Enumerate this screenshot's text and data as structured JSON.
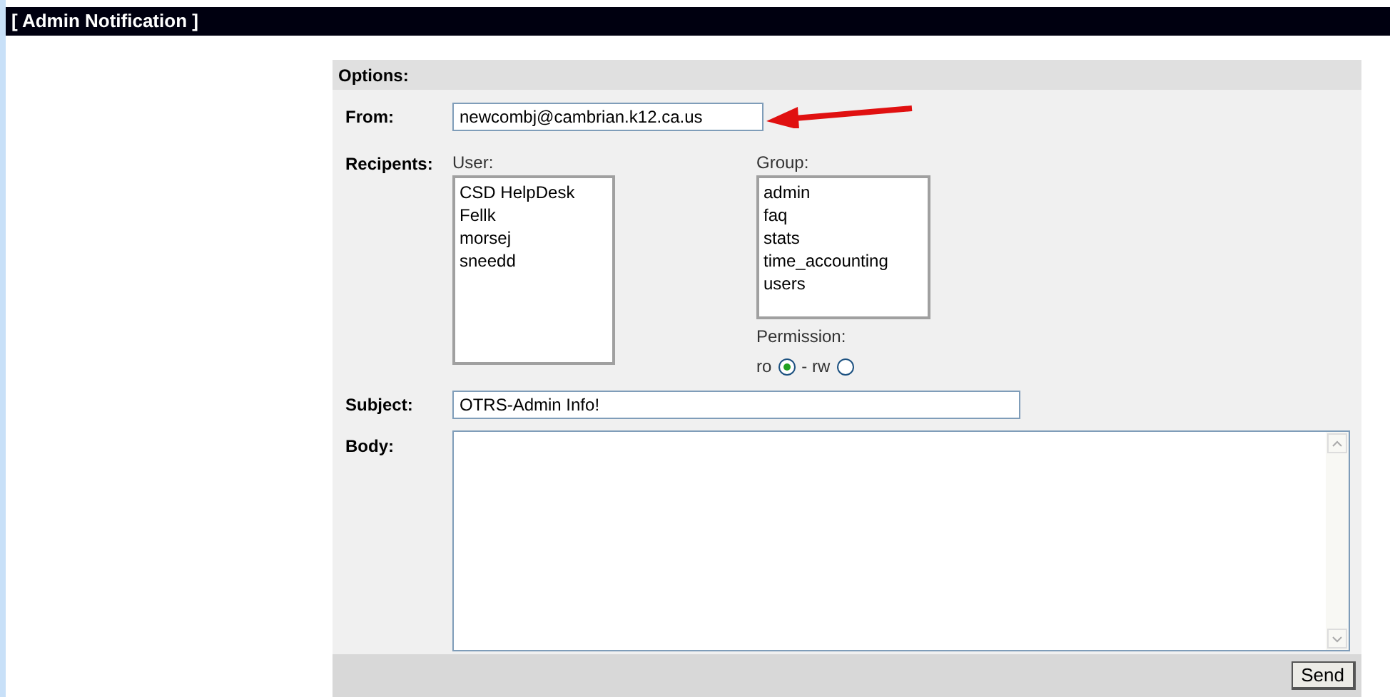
{
  "title": "[ Admin Notification ]",
  "options": {
    "header": "Options:",
    "from": {
      "label": "From:",
      "value": "newcombj@cambrian.k12.ca.us"
    },
    "recipients": {
      "label": "Recipents:",
      "user_label": "User:",
      "users": [
        "CSD HelpDesk",
        "Fellk",
        "morsej",
        "sneedd"
      ],
      "group_label": "Group:",
      "groups": [
        "admin",
        "faq",
        "stats",
        "time_accounting",
        "users"
      ],
      "permission_label": "Permission:",
      "permissions": [
        {
          "label": "ro",
          "selected": true
        },
        {
          "label": "- rw",
          "selected": false
        }
      ]
    },
    "subject": {
      "label": "Subject:",
      "value": "OTRS-Admin Info!"
    },
    "body": {
      "label": "Body:"
    },
    "send_button": "Send"
  }
}
